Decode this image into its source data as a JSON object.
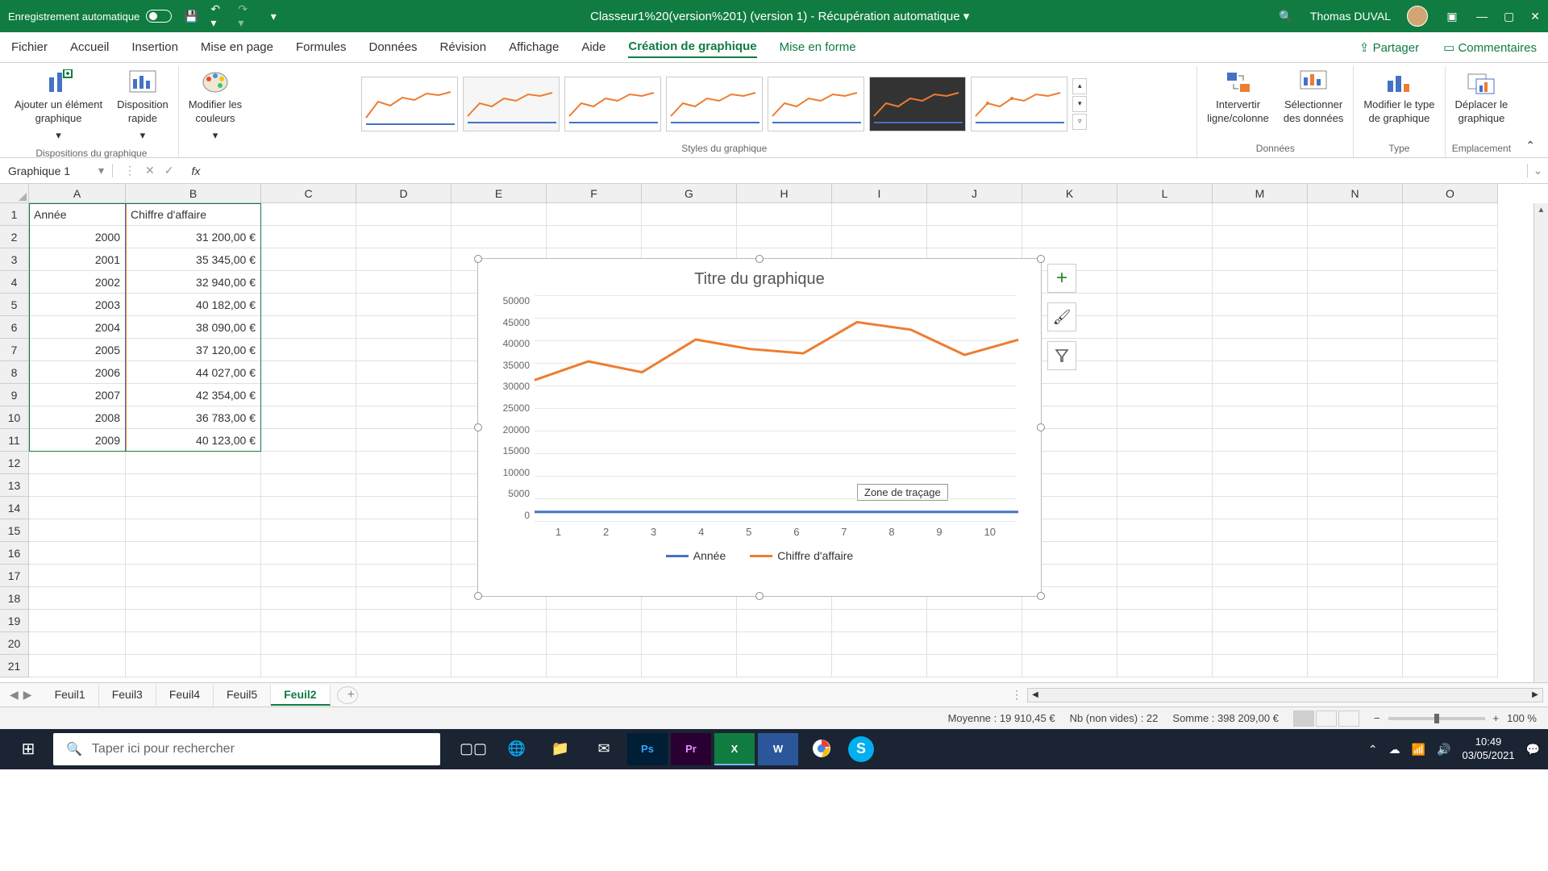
{
  "titlebar": {
    "autosave_label": "Enregistrement automatique",
    "doc_title": "Classeur1%20(version%201) (version 1)  -  Récupération automatique",
    "user_name": "Thomas DUVAL"
  },
  "menu": {
    "items": [
      "Fichier",
      "Accueil",
      "Insertion",
      "Mise en page",
      "Formules",
      "Données",
      "Révision",
      "Affichage",
      "Aide",
      "Création de graphique",
      "Mise en forme"
    ],
    "active": "Création de graphique",
    "share": "Partager",
    "comments": "Commentaires"
  },
  "ribbon": {
    "group_layout": {
      "label": "Dispositions du graphique",
      "btn_add": "Ajouter un élément\ngraphique",
      "btn_quick": "Disposition\nrapide",
      "btn_colors": "Modifier les\ncouleurs"
    },
    "group_styles": {
      "label": "Styles du graphique"
    },
    "group_data": {
      "label": "Données",
      "btn_switch": "Intervertir\nligne/colonne",
      "btn_select": "Sélectionner\ndes données"
    },
    "group_type": {
      "label": "Type",
      "btn_change": "Modifier le type\nde graphique"
    },
    "group_loc": {
      "label": "Emplacement",
      "btn_move": "Déplacer le\ngraphique"
    }
  },
  "formula_bar": {
    "name_box": "Graphique 1",
    "fx": "fx"
  },
  "grid": {
    "columns": [
      "A",
      "B",
      "C",
      "D",
      "E",
      "F",
      "G",
      "H",
      "I",
      "J",
      "K",
      "L",
      "M",
      "N",
      "O"
    ],
    "header_a": "Année",
    "header_b": "Chiffre d'affaire",
    "rows": [
      {
        "year": "2000",
        "val": "31 200,00 €"
      },
      {
        "year": "2001",
        "val": "35 345,00 €"
      },
      {
        "year": "2002",
        "val": "32 940,00 €"
      },
      {
        "year": "2003",
        "val": "40 182,00 €"
      },
      {
        "year": "2004",
        "val": "38 090,00 €"
      },
      {
        "year": "2005",
        "val": "37 120,00 €"
      },
      {
        "year": "2006",
        "val": "44 027,00 €"
      },
      {
        "year": "2007",
        "val": "42 354,00 €"
      },
      {
        "year": "2008",
        "val": "36 783,00 €"
      },
      {
        "year": "2009",
        "val": "40 123,00 €"
      }
    ]
  },
  "chart_data": {
    "type": "line",
    "title": "Titre du graphique",
    "categories": [
      1,
      2,
      3,
      4,
      5,
      6,
      7,
      8,
      9,
      10
    ],
    "series": [
      {
        "name": "Année",
        "values": [
          2000,
          2001,
          2002,
          2003,
          2004,
          2005,
          2006,
          2007,
          2008,
          2009
        ]
      },
      {
        "name": "Chiffre d'affaire",
        "values": [
          31200,
          35345,
          32940,
          40182,
          38090,
          37120,
          44027,
          42354,
          36783,
          40123
        ]
      }
    ],
    "y_ticks": [
      0,
      5000,
      10000,
      15000,
      20000,
      25000,
      30000,
      35000,
      40000,
      45000,
      50000
    ],
    "x_ticks": [
      1,
      2,
      3,
      4,
      5,
      6,
      7,
      8,
      9,
      10
    ],
    "plot_area_label": "Zone de traçage"
  },
  "sheets": {
    "tabs": [
      "Feuil1",
      "Feuil3",
      "Feuil4",
      "Feuil5",
      "Feuil2"
    ],
    "active": "Feuil2"
  },
  "status": {
    "avg": "Moyenne : 19 910,45 €",
    "count": "Nb (non vides) : 22",
    "sum": "Somme : 398 209,00 €",
    "zoom": "100 %"
  },
  "taskbar": {
    "search_placeholder": "Taper ici pour rechercher",
    "time": "10:49",
    "date": "03/05/2021"
  }
}
